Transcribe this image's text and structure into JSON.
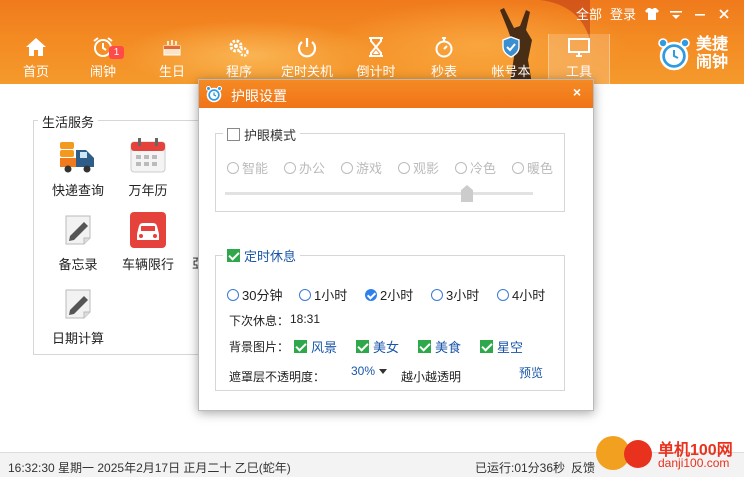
{
  "header": {
    "top_links": {
      "all": "全部",
      "login": "登录"
    },
    "nav": [
      {
        "label": "首页",
        "icon": "home-icon"
      },
      {
        "label": "闹钟",
        "icon": "alarm-clock-icon",
        "badge": "1"
      },
      {
        "label": "生日",
        "icon": "cake-icon"
      },
      {
        "label": "程序",
        "icon": "gears-icon"
      },
      {
        "label": "定时关机",
        "icon": "power-icon"
      },
      {
        "label": "倒计时",
        "icon": "hourglass-icon"
      },
      {
        "label": "秒表",
        "icon": "stopwatch-icon"
      },
      {
        "label": "帐号本",
        "icon": "shield-icon"
      },
      {
        "label": "工具",
        "icon": "monitor-icon",
        "active": true
      }
    ],
    "brand": {
      "line1": "美捷",
      "line2": "闹钟"
    }
  },
  "main": {
    "group_title": "生活服务",
    "services": [
      {
        "label": "快递查询",
        "icon": "delivery-truck-icon"
      },
      {
        "label": "万年历",
        "icon": "calendar-icon"
      },
      {
        "label": "备忘录",
        "icon": "memo-pencil-icon"
      },
      {
        "label": "车辆限行",
        "icon": "car-icon"
      },
      {
        "label": "日期计算",
        "icon": "date-calc-icon"
      }
    ],
    "partial_label": "亞"
  },
  "dialog": {
    "title": "护眼设置",
    "close": "×",
    "eye_mode": {
      "label": "护眼模式",
      "checked": false,
      "options": [
        "智能",
        "办公",
        "游戏",
        "观影",
        "冷色",
        "暖色"
      ]
    },
    "timed_rest": {
      "label": "定时休息",
      "checked": true,
      "options": [
        "30分钟",
        "1小时",
        "2小时",
        "3小时",
        "4小时"
      ],
      "selected": "2小时",
      "next_rest_label": "下次休息：",
      "next_rest_time": "18:31",
      "bg_label": "背景图片：",
      "bg_options": [
        "风景",
        "美女",
        "美食",
        "星空"
      ],
      "opacity_label": "遮罩层不透明度：",
      "opacity_value": "30%",
      "opacity_hint": "越小越透明",
      "preview": "预览"
    }
  },
  "status": {
    "datetime": "16:32:30 星期一 2025年2月17日 正月二十 乙巳(蛇年)",
    "running": "已运行:01分36秒",
    "feedback": "反馈"
  },
  "watermark": {
    "site": "单机100网",
    "url": "danji100.com"
  },
  "colors": {
    "accent": "#f07a1c",
    "check": "#2ea84a",
    "radio": "#2f80ed",
    "link": "#1a56a8"
  }
}
